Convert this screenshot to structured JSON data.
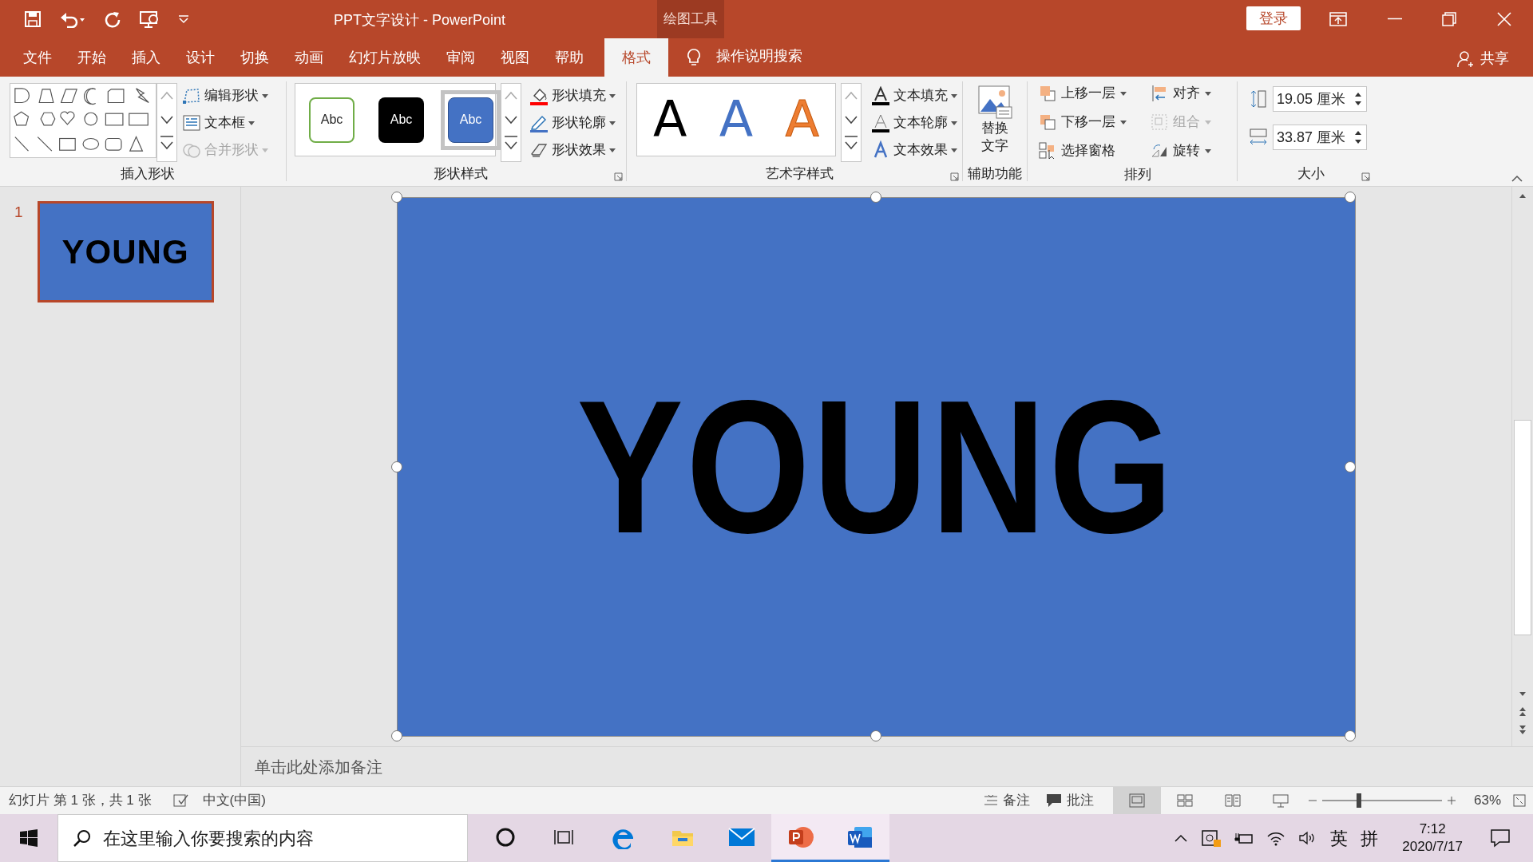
{
  "title_bar": {
    "title": "PPT文字设计  -  PowerPoint",
    "context_group": "绘图工具",
    "login_button": "登录"
  },
  "tabs": [
    {
      "label": "文件",
      "selected": false
    },
    {
      "label": "开始",
      "selected": false
    },
    {
      "label": "插入",
      "selected": false
    },
    {
      "label": "设计",
      "selected": false
    },
    {
      "label": "切换",
      "selected": false
    },
    {
      "label": "动画",
      "selected": false
    },
    {
      "label": "幻灯片放映",
      "selected": false
    },
    {
      "label": "审阅",
      "selected": false
    },
    {
      "label": "视图",
      "selected": false
    },
    {
      "label": "帮助",
      "selected": false
    },
    {
      "label": "格式",
      "selected": true
    }
  ],
  "tell_me": "操作说明搜索",
  "share": "共享",
  "ribbon": {
    "insert_shapes": {
      "label": "插入形状",
      "commands": [
        {
          "label": "编辑形状",
          "disabled": false
        },
        {
          "label": "文本框",
          "disabled": false
        },
        {
          "label": "合并形状",
          "disabled": true
        }
      ]
    },
    "shape_styles": {
      "label": "形状样式",
      "presets": [
        {
          "kind": "outline",
          "label": "Abc",
          "selected": false
        },
        {
          "kind": "dark",
          "label": "Abc",
          "selected": false
        },
        {
          "kind": "blue",
          "label": "Abc",
          "selected": true
        }
      ],
      "commands": [
        {
          "kind": "fill",
          "label": "形状填充"
        },
        {
          "kind": "outline",
          "label": "形状轮廓"
        },
        {
          "kind": "effects",
          "label": "形状效果"
        }
      ]
    },
    "wordart_styles": {
      "label": "艺术字样式",
      "presets": [
        {
          "kind": "black",
          "label": "A"
        },
        {
          "kind": "blue",
          "label": "A"
        },
        {
          "kind": "orange",
          "label": "A"
        }
      ],
      "commands": [
        {
          "kind": "fill",
          "label": "文本填充"
        },
        {
          "kind": "outline",
          "label": "文本轮廓"
        },
        {
          "kind": "effects",
          "label": "文本效果"
        }
      ]
    },
    "accessibility": {
      "label": "辅助功能",
      "button": [
        "替换",
        "文字"
      ]
    },
    "arrange": {
      "label": "排列",
      "commands": [
        {
          "kind": "forward",
          "label": "上移一层",
          "disabled": false
        },
        {
          "kind": "align",
          "label": "对齐",
          "disabled": false
        },
        {
          "kind": "backward",
          "label": "下移一层",
          "disabled": false
        },
        {
          "kind": "group",
          "label": "组合",
          "disabled": true
        },
        {
          "kind": "pane",
          "label": "选择窗格",
          "disabled": false
        },
        {
          "kind": "rotate",
          "label": "旋转",
          "disabled": false
        }
      ]
    },
    "size": {
      "label": "大小",
      "height": "19.05 厘米",
      "width": "33.87 厘米"
    }
  },
  "thumbnails": [
    {
      "number": "1",
      "text": "YOUNG",
      "selected": true
    }
  ],
  "slide": {
    "text": "YOUNG",
    "selected": true
  },
  "notes_placeholder": "单击此处添加备注",
  "status_bar": {
    "slide_info": "幻灯片 第 1 张，共 1 张",
    "language": "中文(中国)",
    "notes": "备注",
    "comments": "批注",
    "views": [
      {
        "kind": "normal",
        "selected": true
      },
      {
        "kind": "sorter",
        "selected": false
      },
      {
        "kind": "reading",
        "selected": false
      },
      {
        "kind": "show",
        "selected": false
      }
    ],
    "zoom": {
      "level": 0.31,
      "reading": "63%"
    }
  },
  "taskbar": {
    "search_placeholder": "在这里输入你要搜索的内容",
    "apps": [
      {
        "kind": "cortana",
        "running": false
      },
      {
        "kind": "taskview",
        "running": false
      },
      {
        "kind": "edge",
        "running": false
      },
      {
        "kind": "explorer",
        "running": false
      },
      {
        "kind": "mail",
        "running": false
      },
      {
        "kind": "powerpoint",
        "running": true
      },
      {
        "kind": "word",
        "running": true
      }
    ],
    "ime": [
      "英",
      "拼"
    ],
    "time": "7:12",
    "date": "2020/7/17"
  }
}
